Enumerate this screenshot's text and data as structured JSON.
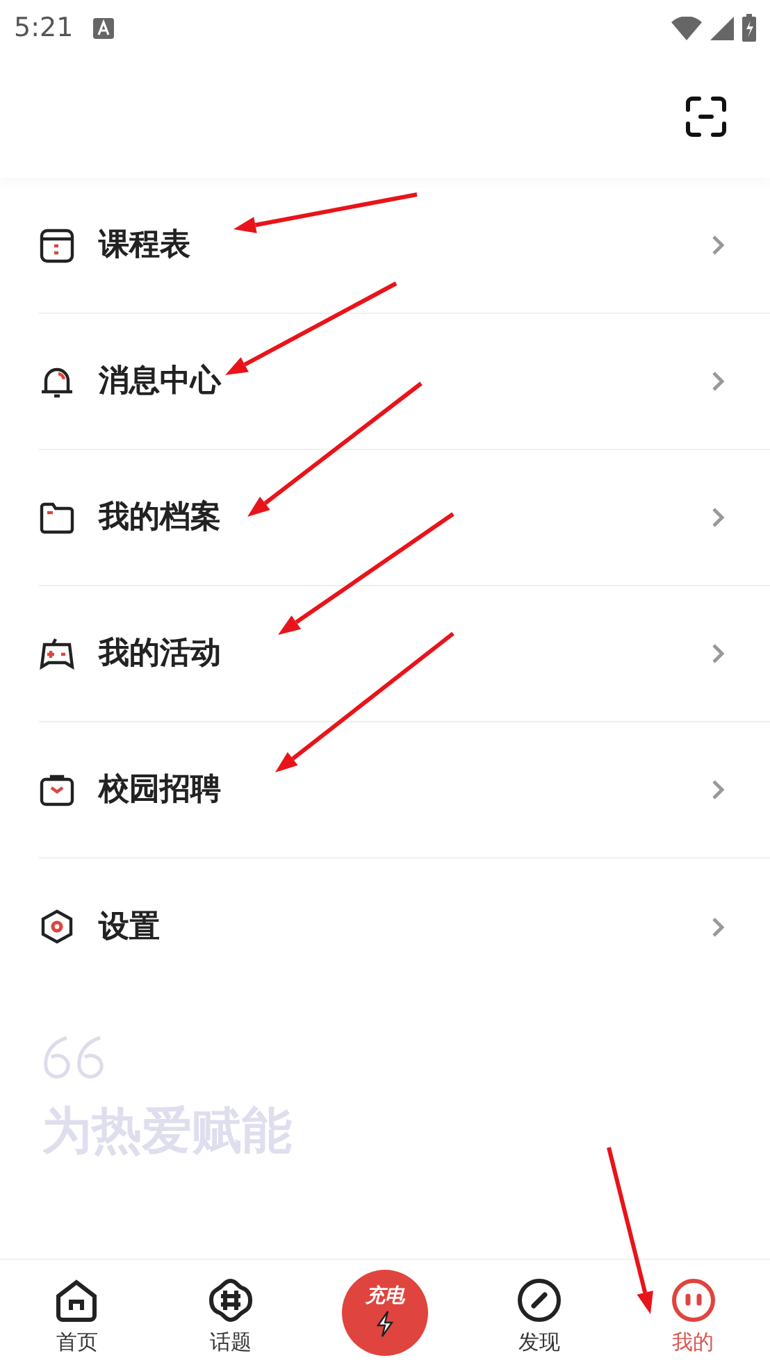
{
  "status_bar": {
    "time": "5:21"
  },
  "menu": [
    {
      "label": "课程表"
    },
    {
      "label": "消息中心"
    },
    {
      "label": "我的档案"
    },
    {
      "label": "我的活动"
    },
    {
      "label": "校园招聘"
    },
    {
      "label": "设置"
    }
  ],
  "slogan": "为热爱赋能",
  "bottom_nav": [
    {
      "kind": "tab",
      "label": "首页",
      "selected": false
    },
    {
      "kind": "tab",
      "label": "话题",
      "selected": false
    },
    {
      "kind": "charge",
      "label": "充电"
    },
    {
      "kind": "tab",
      "label": "发现",
      "selected": false
    },
    {
      "kind": "tab",
      "label": "我的",
      "selected": true
    }
  ]
}
